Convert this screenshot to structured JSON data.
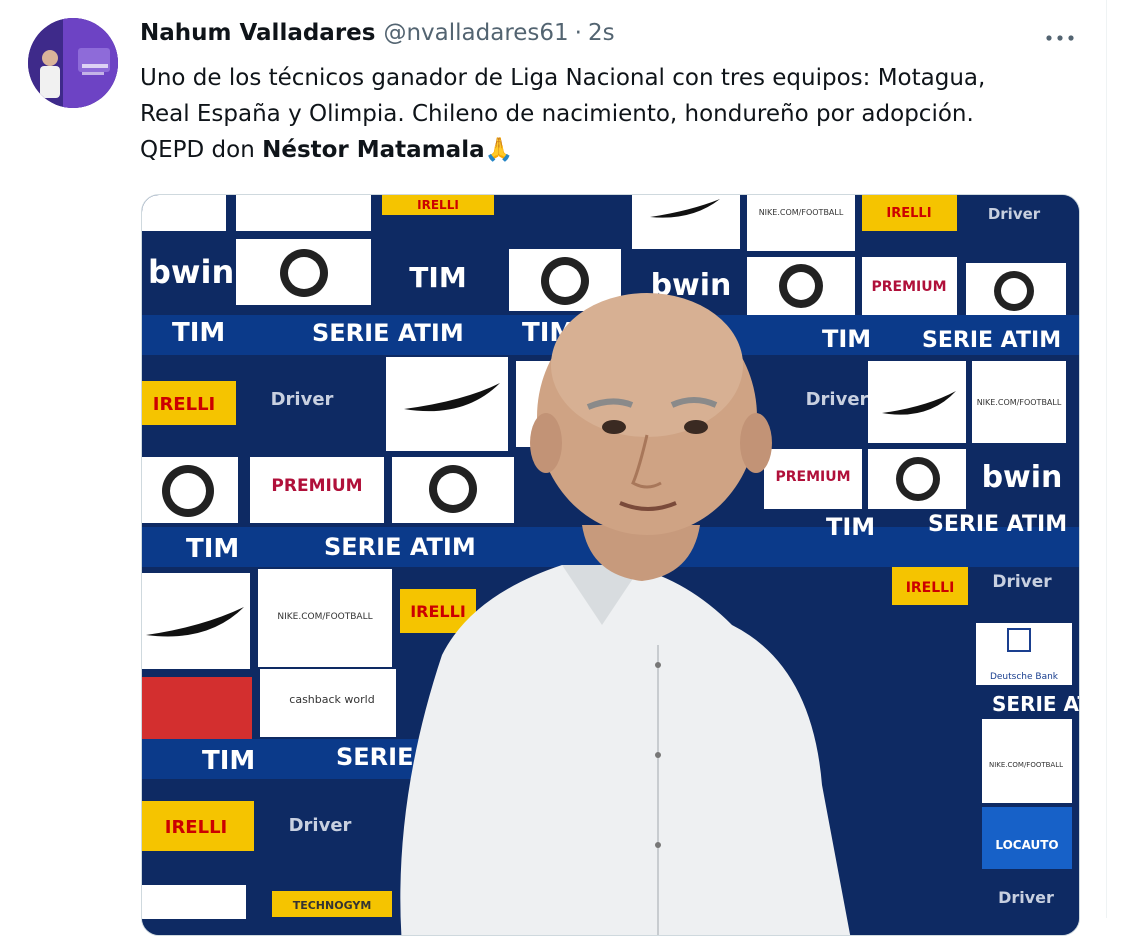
{
  "tweet": {
    "author_name": "Nahum Valladares",
    "handle": "@nvalladares61",
    "separator": "·",
    "time": "2s",
    "text_line1": "Uno de los técnicos ganador de Liga Nacional con tres equipos: Motagua,",
    "text_line2": "Real España y Olimpia. Chileno de nacimiento, hondureño por adopción.",
    "text_line3_prefix": "QEPD don ",
    "text_line3_bold": "Néstor Matamala",
    "emoji": "🙏"
  },
  "icons": {
    "more": "more-horizontal-icon",
    "avatar": "avatar"
  },
  "media": {
    "backdrop_labels": {
      "tim": "TIM",
      "serie_a": "SERIE ATIM",
      "bwin": "bwin",
      "pirelli": "IRELLI",
      "driver": "Driver",
      "premium": "PREMIUM",
      "nike_football": "NIKE.COM/FOOTBALL",
      "cashback": "cashback world",
      "deutsche": "Deutsche Bank",
      "locauto": "LOCAUTO",
      "technogym": "TECHNOGYM"
    }
  },
  "colors": {
    "text": "#0f1419",
    "secondary": "#536471",
    "backdrop_blue": "#10306b",
    "shirt": "#eef0f2"
  }
}
